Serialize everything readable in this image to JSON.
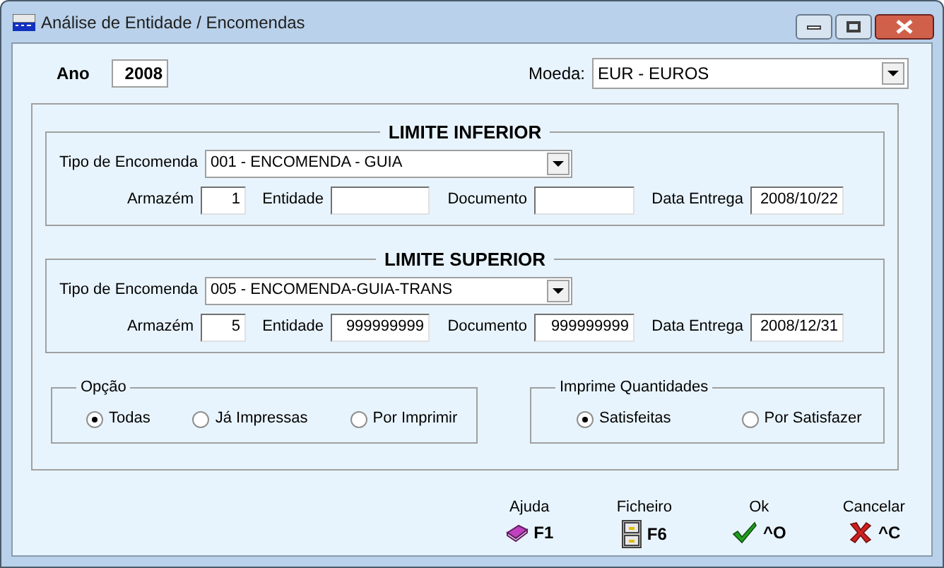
{
  "window": {
    "title": "Análise de Entidade / Encomendas"
  },
  "year": {
    "label": "Ano",
    "value": "2008"
  },
  "currency": {
    "label": "Moeda:",
    "value": "EUR - EUROS"
  },
  "limits": [
    {
      "title": "LIMITE INFERIOR",
      "order_type": {
        "label": "Tipo de Encomenda",
        "value": "001 - ENCOMENDA - GUIA"
      },
      "fields": [
        {
          "label": "Armazém",
          "value": "1"
        },
        {
          "label": "Entidade"
        },
        {
          "label": "Documento"
        },
        {
          "label": "Data Entrega",
          "value": "2008/10/22"
        }
      ]
    },
    {
      "title": "LIMITE SUPERIOR",
      "order_type": {
        "label": "Tipo de Encomenda",
        "value": "005 - ENCOMENDA-GUIA-TRANS"
      },
      "fields": [
        {
          "label": "Armazém",
          "value": "5"
        },
        {
          "label": "Entidade",
          "value": "999999999"
        },
        {
          "label": "Documento",
          "value": "999999999"
        },
        {
          "label": "Data Entrega",
          "value": "2008/12/31"
        }
      ]
    }
  ],
  "option_groups": [
    {
      "title": "Opção",
      "options": [
        {
          "label": "Todas",
          "selected": true
        },
        {
          "label": "Já Impressas",
          "selected": false
        },
        {
          "label": "Por Imprimir",
          "selected": false
        }
      ]
    },
    {
      "title": "Imprime Quantidades",
      "options": [
        {
          "label": "Satisfeitas",
          "selected": true
        },
        {
          "label": "Por Satisfazer",
          "selected": false
        }
      ]
    }
  ],
  "actions": [
    {
      "kind": "help",
      "label": "Ajuda",
      "shortcut": "F1"
    },
    {
      "kind": "file",
      "label": "Ficheiro",
      "shortcut": "F6"
    },
    {
      "kind": "ok",
      "label": "Ok",
      "shortcut": "^O"
    },
    {
      "kind": "cancel",
      "label": "Cancelar",
      "shortcut": "^C"
    }
  ]
}
